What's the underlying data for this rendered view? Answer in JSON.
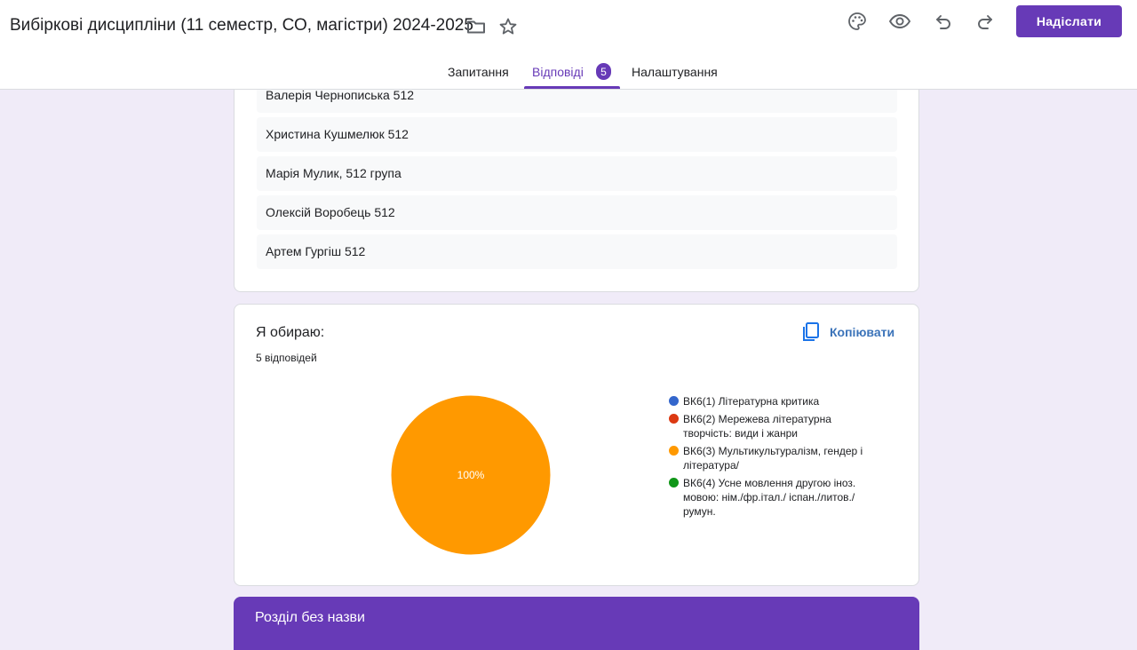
{
  "header": {
    "title": "Вибіркові дисципліни (11 семестр, СО, магістри) 2024-2025",
    "send_label": "Надіслати"
  },
  "tabs": [
    {
      "label": "Запитання"
    },
    {
      "label": "Відповіді",
      "badge": "5",
      "active": true
    },
    {
      "label": "Налаштування"
    }
  ],
  "responses": [
    "Валерія Чернописька 512",
    "Христина Кушмелюк 512",
    "Марія Мулик, 512 група",
    "Олексій Воробець 512",
    "Артем Гургіш 512"
  ],
  "question": {
    "title": "Я обираю:",
    "count": "5 відповідей",
    "copy_label": "Копіювати"
  },
  "chart_data": {
    "type": "pie",
    "categories": [
      "ВК6(1) Літературна критика",
      "ВК6(2) Мережева літературна творчість: види і жанри",
      "ВК6(3) Мультикультуралізм, гендер і література/",
      "ВК6(4) Усне мовлення другою іноз. мовою: нім./фр.італ./ іспан./литов./ румун."
    ],
    "values": [
      0,
      0,
      100,
      0
    ],
    "colors": [
      "#3366cc",
      "#dc3912",
      "#ff9900",
      "#109618"
    ],
    "slice_label": "100%",
    "legend_position": "right"
  },
  "legend": [
    {
      "lines": [
        "ВК6(1) Літературна критика"
      ]
    },
    {
      "lines": [
        "ВК6(2) Мережева літературна",
        "творчість: види і жанри"
      ]
    },
    {
      "lines": [
        "ВК6(3) Мультикультуралізм, гендер і",
        "література/"
      ]
    },
    {
      "lines": [
        "ВК6(4) Усне мовлення другою іноз.",
        "мовою: нім./фр.італ./ іспан./литов./",
        "румун."
      ]
    }
  ],
  "section": {
    "title": "Розділ без назви"
  },
  "colors": {
    "accent": "#673ab7",
    "background": "#f0ebf8"
  }
}
